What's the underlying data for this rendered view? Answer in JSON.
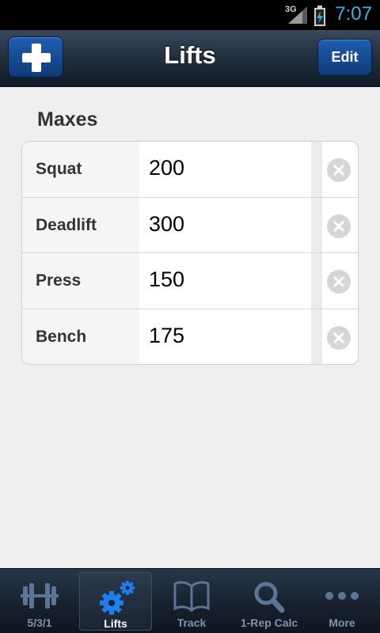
{
  "status_bar": {
    "network": "3G",
    "time": "7:07"
  },
  "header": {
    "title": "Lifts",
    "edit_label": "Edit"
  },
  "maxes": {
    "title": "Maxes",
    "rows": [
      {
        "label": "Squat",
        "value": "200"
      },
      {
        "label": "Deadlift",
        "value": "300"
      },
      {
        "label": "Press",
        "value": "150"
      },
      {
        "label": "Bench",
        "value": "175"
      }
    ]
  },
  "tabs": [
    {
      "label": "5/3/1",
      "icon": "barbell-icon",
      "active": false
    },
    {
      "label": "Lifts",
      "icon": "gears-icon",
      "active": true
    },
    {
      "label": "Track",
      "icon": "book-icon",
      "active": false
    },
    {
      "label": "1-Rep Calc",
      "icon": "magnifier-icon",
      "active": false
    },
    {
      "label": "More",
      "icon": "more-dots-icon",
      "active": false
    }
  ],
  "colors": {
    "accent_blue": "#1e5fb0",
    "clock_blue": "#33b5e5",
    "tab_inactive": "#7f93ad"
  }
}
